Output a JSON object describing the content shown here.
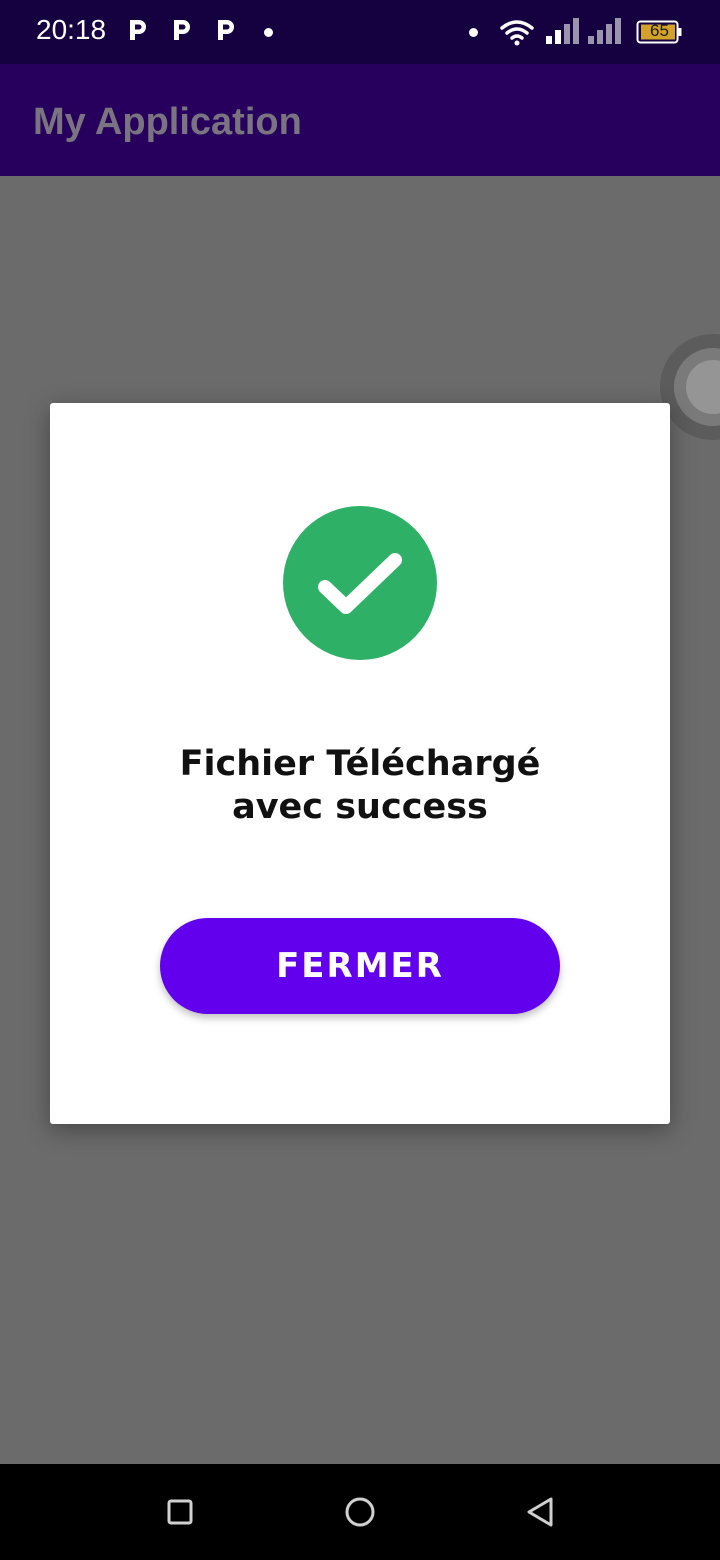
{
  "status_bar": {
    "time": "20:18",
    "notification_icons": [
      "p-app-icon",
      "p-app-icon",
      "p-app-icon",
      "more-dot-icon"
    ],
    "battery_level": "65",
    "icons": [
      "dot-icon",
      "wifi-icon",
      "signal-icon",
      "signal-icon",
      "battery-icon"
    ]
  },
  "app_bar": {
    "title": "My Application",
    "background": "#27005e"
  },
  "dialog": {
    "icon": "success-check-icon",
    "icon_color": "#2eb067",
    "message": "Fichier Téléchargé\navec success",
    "close_label": "FERMER",
    "button_color": "#6200ee"
  },
  "nav_bar": {
    "buttons": [
      "recents-square-icon",
      "home-circle-icon",
      "back-triangle-icon"
    ]
  }
}
